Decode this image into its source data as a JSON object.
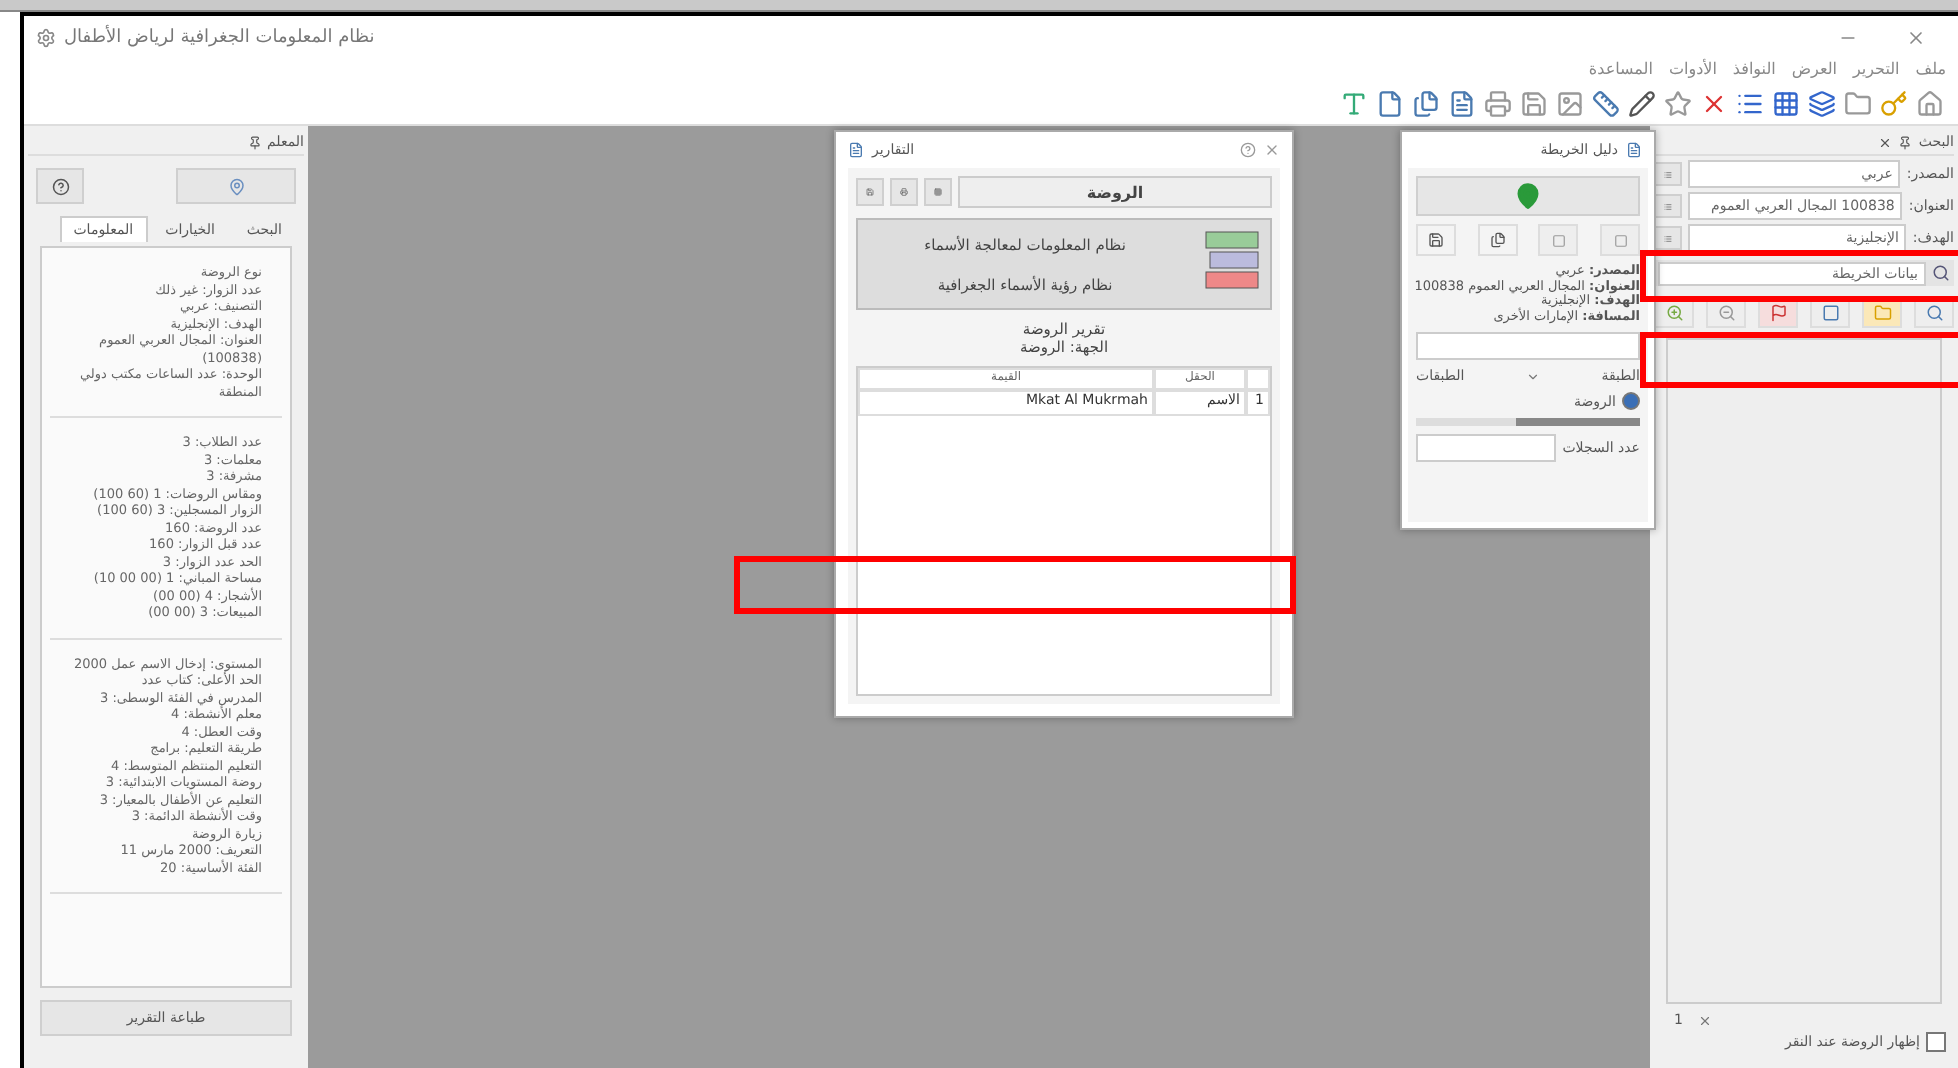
{
  "window": {
    "title": "نظام المعلومات الجغرافية لرياض الأطفال"
  },
  "menu": [
    "ملف",
    "التحرير",
    "العرض",
    "النوافذ",
    "الأدوات",
    "المساعدة"
  ],
  "left_panel": {
    "title": "المعلم",
    "tabs": [
      {
        "label": "البحث",
        "selected": false
      },
      {
        "label": "الخيارات",
        "selected": false
      },
      {
        "label": "المعلومات",
        "selected": true
      }
    ],
    "sections": [
      [
        "نوع الروضة",
        "عدد الزوار: غير ذلك",
        "التصنيف: عربي",
        "الهدف: الإنجليزية",
        "العنوان: المجال العربي العموم (100838)",
        "الوحدة: عدد الساعات مكتب دولي",
        "المنطقة"
      ],
      [
        "عدد الطلاب: 3",
        "معلمات: 3",
        "مشرفة: 3",
        "ومقاس الروضات: 1 (60 100)",
        "الزوار المسجلين: 3 (60 100)",
        "عدد الروضة: 160",
        "عدد قبل الزوار: 160",
        "الحد عدد الزوار: 3",
        "مساحة المباني: 1 (00 00 10)",
        "الأشجار: 4 (00 00)",
        "المبيعات: 3 (00 00)"
      ],
      [
        "المستوى: إدخال الاسم عمل 2000",
        "الحد الأعلى: كتاب عدد",
        "المدرس في الفئة الوسطى: 3",
        "معلم الأنشطة: 4",
        "وقت العطل: 4",
        "طريقة التعليم: برامج",
        "التعليم المنتظم المتوسط: 4",
        "روضة المستويات الابتدائية: 3",
        "التعليم عن الأطفال بالمعيار: 3",
        "وقت الأنشطة الدائمة: 3",
        "زيارة الروضة",
        "التعريف: 2000 مارس 11",
        "الفئة الأساسية: 20"
      ]
    ],
    "button": "طباعة التقرير"
  },
  "report_dialog": {
    "title": "التقارير",
    "header": "الروضة",
    "card_lines": [
      "نظام المعلومات لمعالجة الأسماء",
      "نظام رؤية الأسماء الجغرافية"
    ],
    "subtitle_lines": [
      "تقرير الروضة",
      "الجهة: الروضة"
    ],
    "table": {
      "columns": [
        "الحقل",
        "القيمة"
      ],
      "rows": [
        {
          "number": "1",
          "cells": [
            "الاسم",
            "Mkat Al Mukrmah"
          ]
        }
      ]
    }
  },
  "map_panel": {
    "title": "دليل الخريطة",
    "info": [
      {
        "label": "المصدر:",
        "value": "عربي"
      },
      {
        "label": "العنوان:",
        "value": "المجال العربي العموم 100838"
      },
      {
        "label": "الهدف:",
        "value": "الإنجليزية"
      },
      {
        "label": "المسافة:",
        "value": "الإمارات الأخرى"
      }
    ],
    "layer_columns": [
      "الطبقة",
      "الطبقات"
    ],
    "layers": [
      {
        "label": "الروضة",
        "selected": true
      }
    ],
    "opacity": {
      "level": 0.55
    },
    "count_label": "عدد السجلات"
  },
  "right_panel": {
    "title": "البحث",
    "fields": [
      {
        "label": "المصدر:",
        "value": "عربي"
      },
      {
        "label": "العنوان:",
        "value": "100838 المجال العربي العموم"
      },
      {
        "label": "الهدف:",
        "value": "الإنجليزية"
      }
    ],
    "search": {
      "value": "بيانات الخريطة"
    },
    "page": "1",
    "option": {
      "label": "إظهار الروضة عند النقر",
      "checked": false
    }
  },
  "highlights": [
    {
      "kind": "frame"
    },
    {
      "kind": "frame"
    },
    {
      "kind": "frame"
    }
  ]
}
